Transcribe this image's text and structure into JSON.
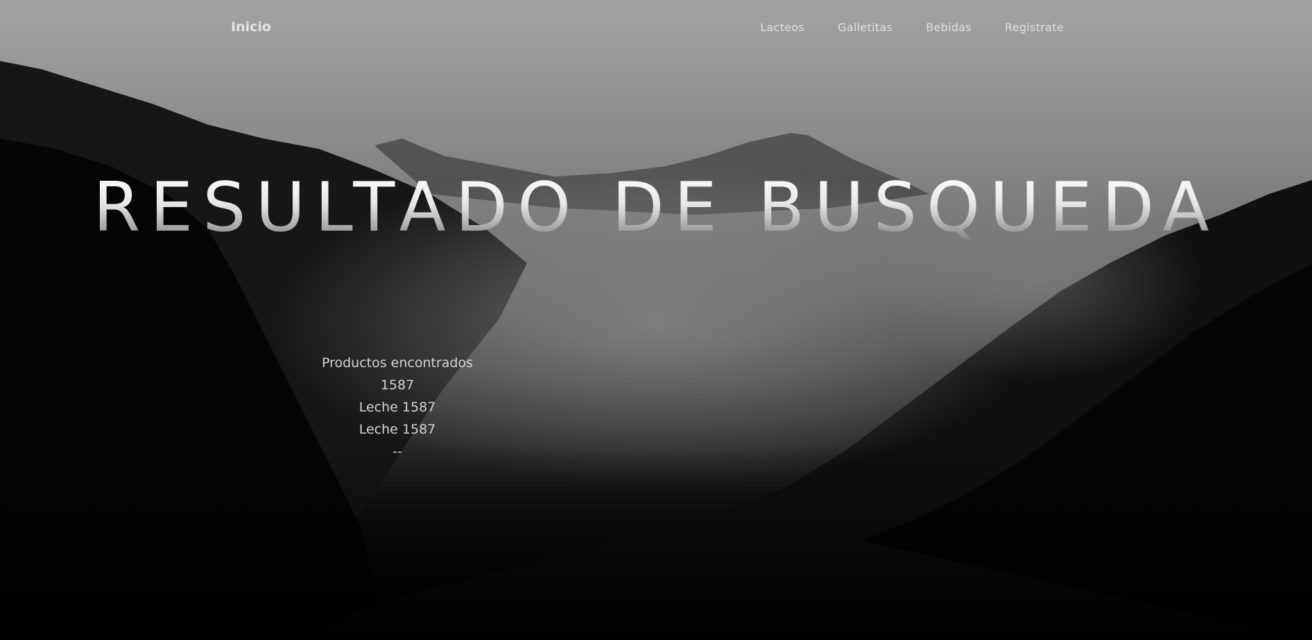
{
  "navbar": {
    "brand": "Inicio",
    "links": [
      "Lacteos",
      "Galletitas",
      "Bebidas",
      "Registrate"
    ]
  },
  "hero": {
    "title": "RESULTADO DE BUSQUEDA"
  },
  "results": {
    "heading": "Productos encontrados",
    "items": [
      "1587",
      "Leche 1587",
      "Leche 1587",
      "--"
    ]
  }
}
